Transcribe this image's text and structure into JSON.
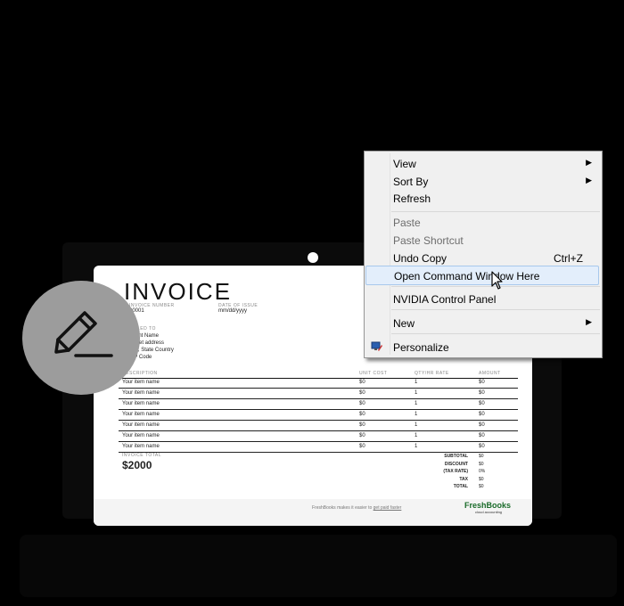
{
  "invoice": {
    "title": "INVOICE",
    "invoice_number_label": "INVOICE NUMBER",
    "invoice_number_value": "00001",
    "date_label": "DATE OF ISSUE",
    "date_value": "mm/dd/yyyy",
    "bill_to_label": "BILLED TO",
    "bill_to_lines": [
      "Client Name",
      "Street address",
      "City, State Country",
      "ZIP Code"
    ],
    "table_headers": [
      "DESCRIPTION",
      "UNIT COST",
      "QTY/HR RATE",
      "AMOUNT"
    ],
    "rows": [
      {
        "desc": "Your item name",
        "cost": "$0",
        "qty": "1",
        "amount": "$0"
      },
      {
        "desc": "Your item name",
        "cost": "$0",
        "qty": "1",
        "amount": "$0"
      },
      {
        "desc": "Your item name",
        "cost": "$0",
        "qty": "1",
        "amount": "$0"
      },
      {
        "desc": "Your item name",
        "cost": "$0",
        "qty": "1",
        "amount": "$0"
      },
      {
        "desc": "Your item name",
        "cost": "$0",
        "qty": "1",
        "amount": "$0"
      },
      {
        "desc": "Your item name",
        "cost": "$0",
        "qty": "1",
        "amount": "$0"
      },
      {
        "desc": "Your item name",
        "cost": "$0",
        "qty": "1",
        "amount": "$0"
      }
    ],
    "total_label": "INVOICE TOTAL",
    "total_value": "$2000",
    "summary": [
      {
        "label": "SUBTOTAL",
        "value": "$0"
      },
      {
        "label": "DISCOUNT",
        "value": "$0"
      },
      {
        "label": "(TAX RATE)",
        "value": "0%"
      },
      {
        "label": "TAX",
        "value": "$0"
      },
      {
        "label": "TOTAL",
        "value": "$0"
      }
    ],
    "footer_text": "FreshBooks makes it easier to",
    "footer_link": "get paid faster",
    "logo_text": "FreshBooks",
    "logo_sub": "cloud accounting"
  },
  "context_menu": {
    "view": "View",
    "sort_by": "Sort By",
    "refresh": "Refresh",
    "paste": "Paste",
    "paste_shortcut": "Paste Shortcut",
    "undo_copy": "Undo Copy",
    "undo_shortcut": "Ctrl+Z",
    "open_command": "Open Command Window Here",
    "nvidia": "NVIDIA Control Panel",
    "new": "New",
    "personalize": "Personalize"
  },
  "icons": {
    "edit": "pencil-icon",
    "personalize": "personalize-icon",
    "submenu": "chevron-right-icon",
    "cursor": "mouse-pointer-icon"
  },
  "colors": {
    "background": "#000000",
    "circle": "#9c9c9c",
    "menu_bg": "#f0f0f0",
    "highlight": "#e3eefb",
    "logo_green": "#1a6b2a"
  }
}
